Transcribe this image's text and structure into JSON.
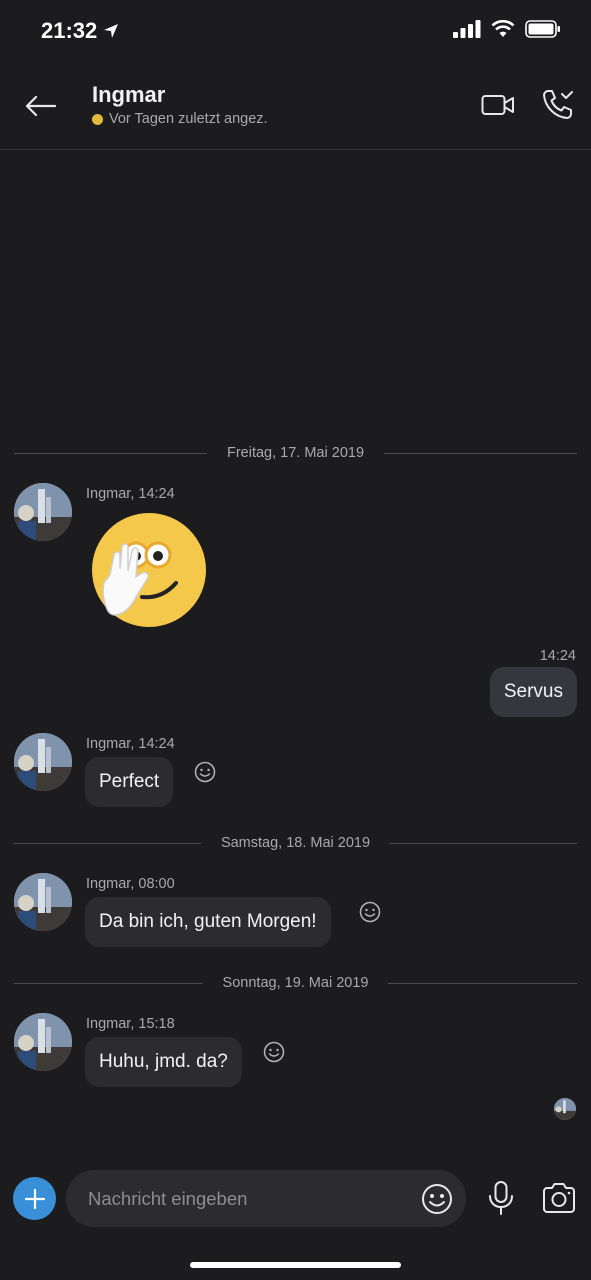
{
  "status_bar": {
    "time": "21:32"
  },
  "header": {
    "contact_name": "Ingmar",
    "presence_text": "Vor Tagen zuletzt angez.",
    "icons": [
      "back-arrow-icon",
      "video-call-icon",
      "phone-call-icon"
    ]
  },
  "conversation": {
    "date_1": "Freitag, 17. Mai 2019",
    "msg_1_meta": "Ingmar, 14:24",
    "msg_1_sticker": "waving-face-sticker",
    "msg_2_time": "14:24",
    "msg_2_text": "Servus",
    "msg_3_meta": "Ingmar, 14:24",
    "msg_3_text": "Perfect",
    "date_2": "Samstag, 18. Mai 2019",
    "msg_4_meta": "Ingmar, 08:00",
    "msg_4_text": "Da bin ich, guten Morgen!",
    "date_3": "Sonntag, 19. Mai 2019",
    "msg_5_meta": "Ingmar, 15:18",
    "msg_5_text": "Huhu, jmd. da?"
  },
  "composer": {
    "placeholder": "Nachricht eingeben",
    "icons": [
      "plus-icon",
      "emoji-icon",
      "microphone-icon",
      "camera-icon"
    ]
  },
  "colors": {
    "background": "#1c1c1e",
    "bubble_incoming": "#2c2c2e",
    "bubble_outgoing": "#34373e",
    "accent": "#3a90d8",
    "presence_away": "#e2b93b"
  }
}
